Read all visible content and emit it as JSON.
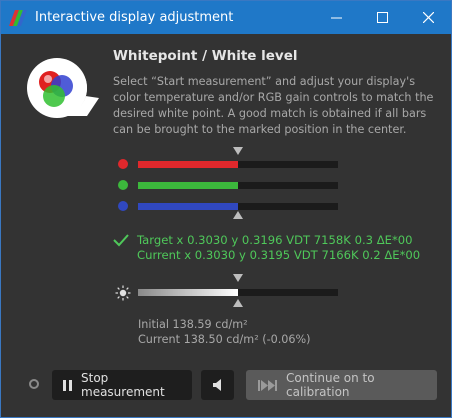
{
  "window": {
    "title": "Interactive display adjustment",
    "controls": [
      "minimize",
      "maximize",
      "close"
    ]
  },
  "header": {
    "heading": "Whitepoint / White level",
    "description": "Select “Start measurement” and adjust your display's color temperature and/or RGB gain controls to match the desired white point. A good match is obtained if all bars can be brought to the marked position in the center."
  },
  "channels": [
    {
      "name": "red",
      "color": "#e0282c",
      "level": 0.5
    },
    {
      "name": "green",
      "color": "#3cb83c",
      "level": 0.5
    },
    {
      "name": "blue",
      "color": "#3048c0",
      "level": 0.5
    }
  ],
  "readout": {
    "target_line": "Target x 0.3030 y 0.3196 VDT 7158K 0.3 ΔE*00",
    "current_line": "Current x 0.3030 y 0.3195 VDT 7166K 0.2 ΔE*00"
  },
  "luminance": {
    "level": 0.5,
    "initial": "Initial 138.59 cd/m²",
    "current": "Current 138.50 cd/m² (-0.06%)"
  },
  "buttons": {
    "stop": "Stop measurement",
    "continue": "Continue on to calibration"
  },
  "icons": {
    "app": "dispcal-app-icon",
    "check": "check-icon",
    "sun": "brightness-icon",
    "pause": "pause-icon",
    "sound": "speaker-icon",
    "skip": "skip-forward-icon"
  },
  "colors": {
    "titlebar": "#1f78c8",
    "accent_green": "#4fc85a",
    "background": "#333333"
  }
}
